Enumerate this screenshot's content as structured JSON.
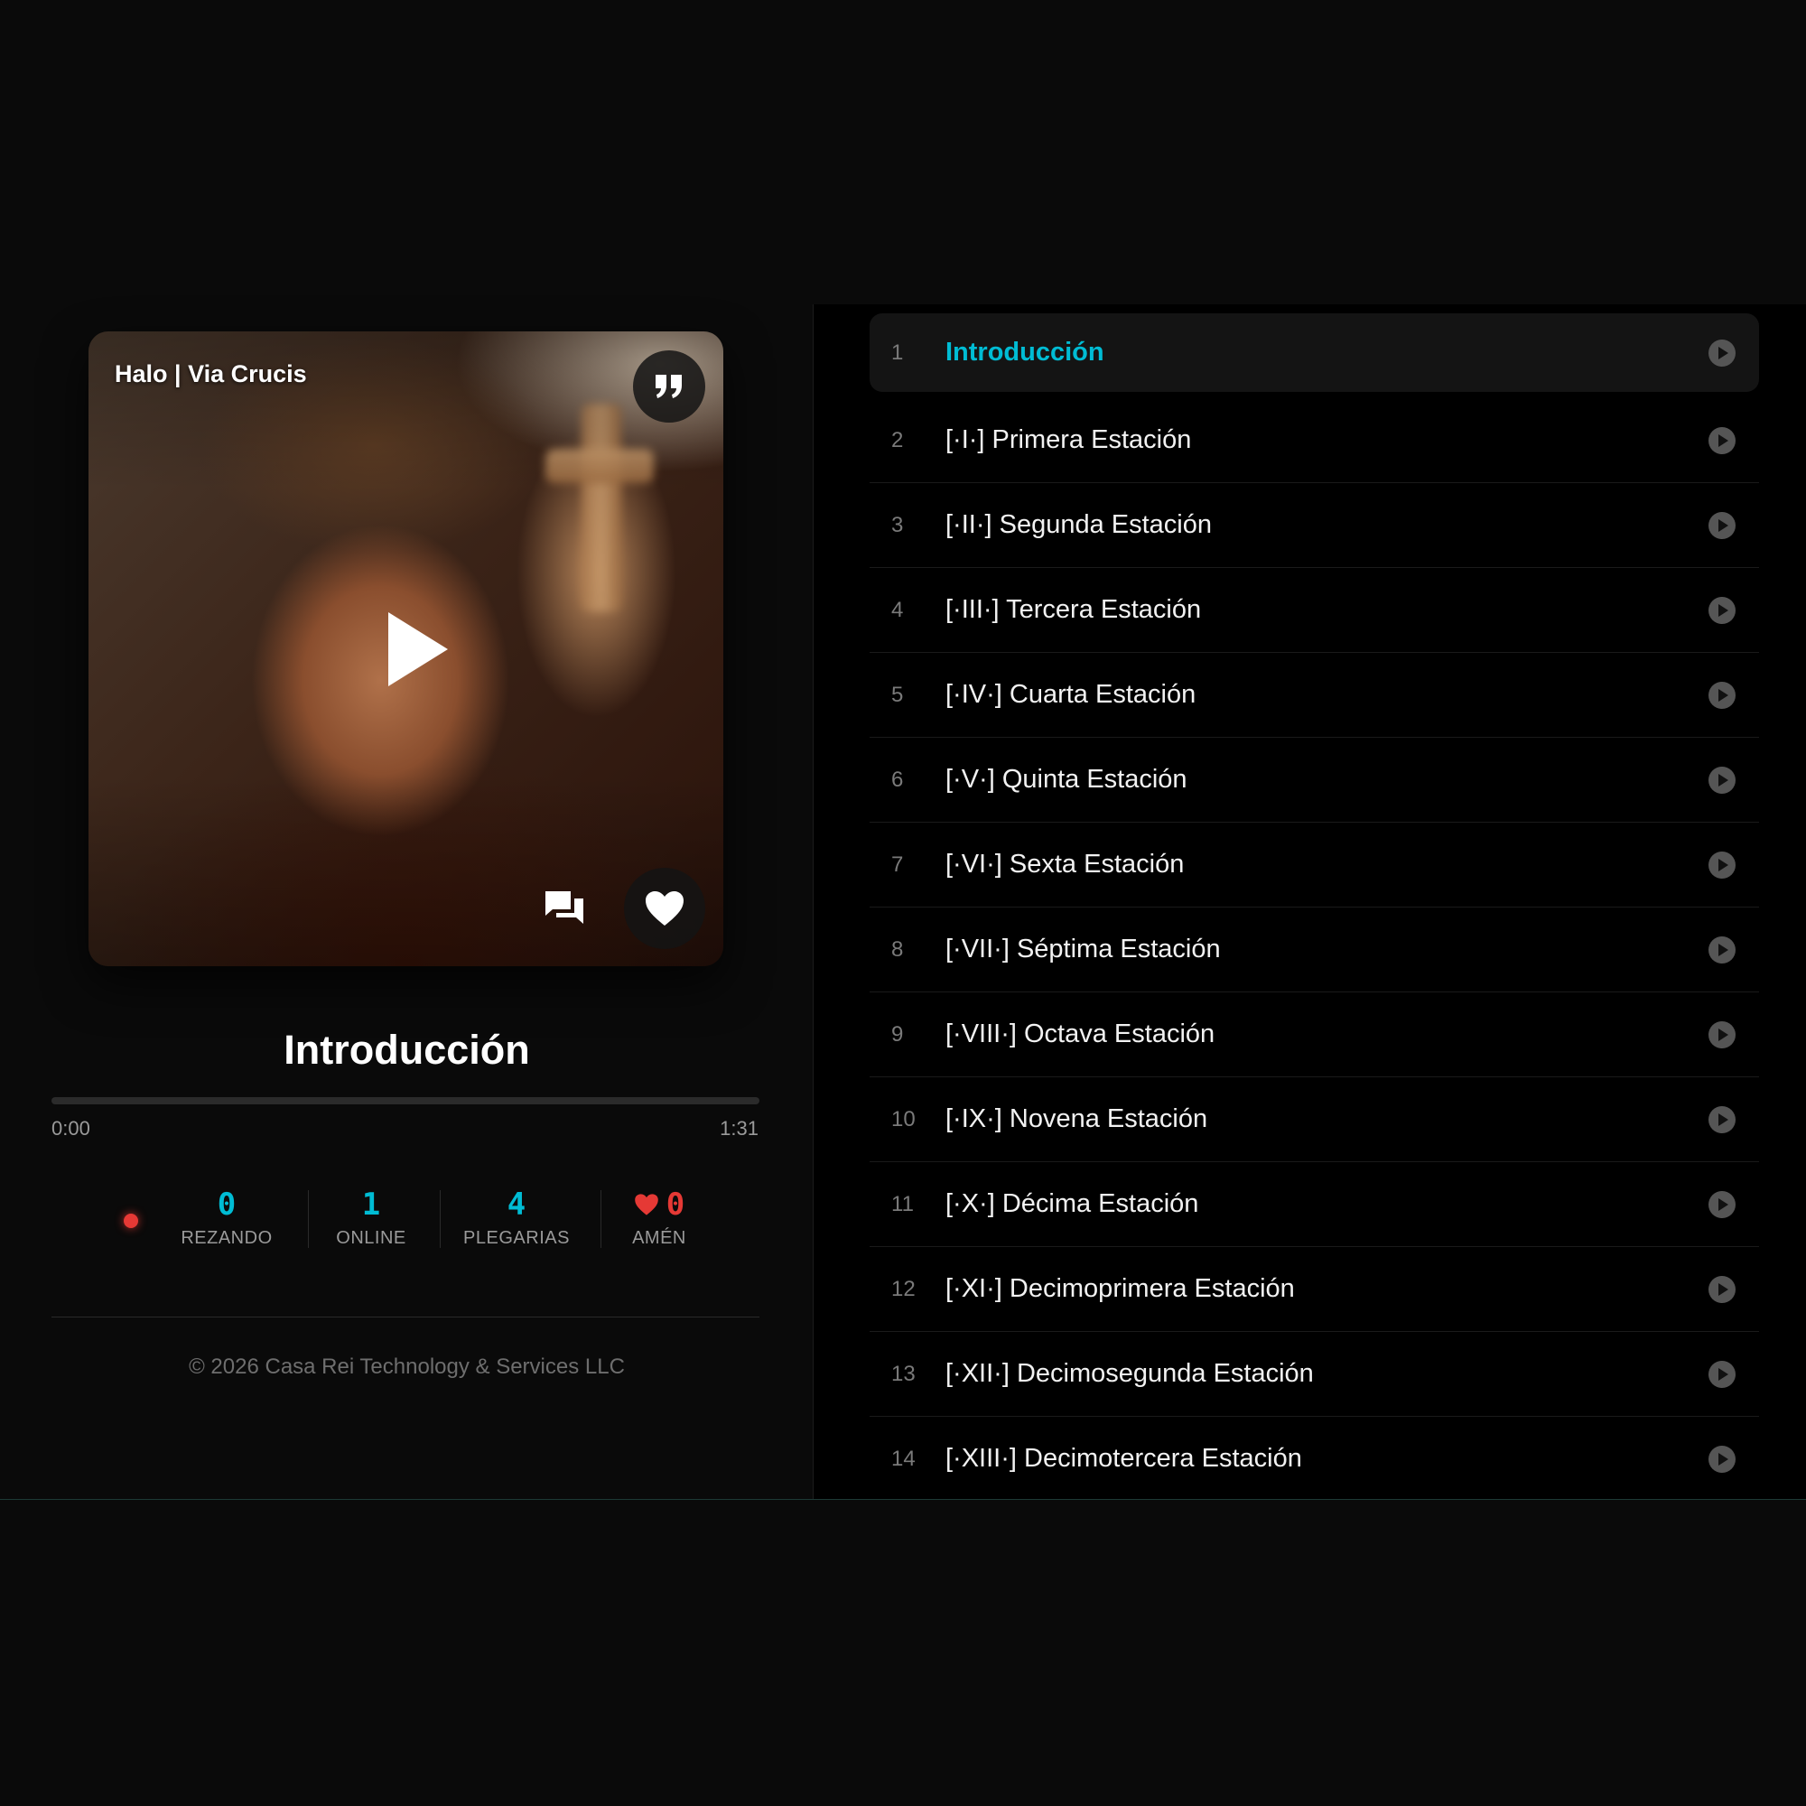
{
  "player": {
    "cover_title": "Halo | Via Crucis",
    "now_playing_title": "Introducción",
    "time_current": "0:00",
    "time_total": "1:31",
    "progress_percent": 0
  },
  "stats": {
    "rezando": {
      "value": "0",
      "label": "REZANDO"
    },
    "online": {
      "value": "1",
      "label": "ONLINE"
    },
    "plegarias": {
      "value": "4",
      "label": "PLEGARIAS"
    },
    "amen": {
      "value": "0",
      "label": "AMÉN"
    }
  },
  "footer": {
    "copyright": "© 2026 Casa Rei Technology & Services LLC"
  },
  "playlist": [
    {
      "num": "1",
      "title": "Introducción",
      "active": true
    },
    {
      "num": "2",
      "title": "[·I·] Primera Estación"
    },
    {
      "num": "3",
      "title": "[·II·] Segunda Estación"
    },
    {
      "num": "4",
      "title": "[·III·] Tercera Estación"
    },
    {
      "num": "5",
      "title": "[·IV·] Cuarta Estación"
    },
    {
      "num": "6",
      "title": "[·V·] Quinta Estación"
    },
    {
      "num": "7",
      "title": "[·VI·] Sexta Estación"
    },
    {
      "num": "8",
      "title": "[·VII·] Séptima Estación"
    },
    {
      "num": "9",
      "title": "[·VIII·] Octava Estación"
    },
    {
      "num": "10",
      "title": "[·IX·] Novena Estación"
    },
    {
      "num": "11",
      "title": "[·X·] Décima Estación"
    },
    {
      "num": "12",
      "title": "[·XI·] Decimoprimera Estación"
    },
    {
      "num": "13",
      "title": "[·XII·] Decimosegunda Estación"
    },
    {
      "num": "14",
      "title": "[·XIII·] Decimotercera Estación"
    }
  ],
  "icons": {
    "quote": "quote-icon",
    "play": "play-icon",
    "comments": "comments-icon",
    "heart": "heart-icon",
    "track_play": "play-circle-icon"
  },
  "colors": {
    "accent": "#00bcd4",
    "live": "#e53935",
    "background": "#0a0a0a",
    "playlist_background": "#000000"
  }
}
